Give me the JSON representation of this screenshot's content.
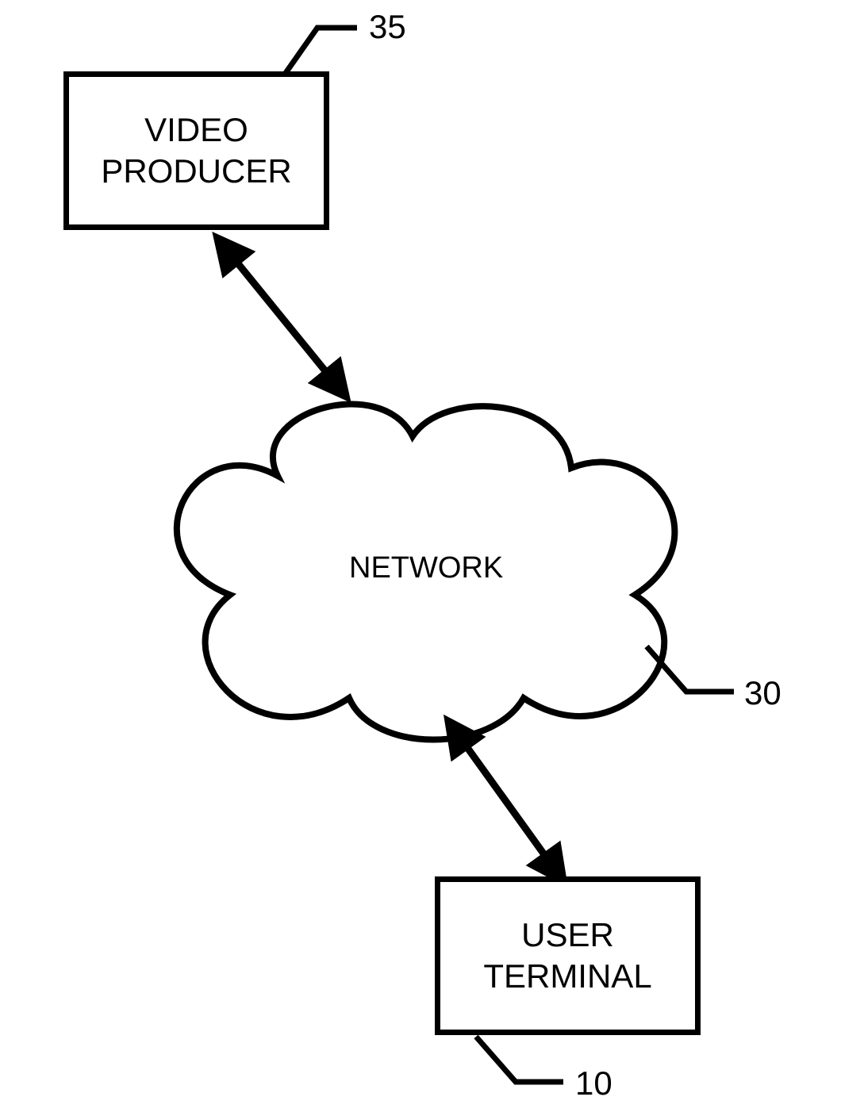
{
  "nodes": {
    "video_producer": {
      "label": "VIDEO\nPRODUCER",
      "callout": "35"
    },
    "network": {
      "label": "NETWORK",
      "callout": "30"
    },
    "user_terminal": {
      "label": "USER\nTERMINAL",
      "callout": "10"
    }
  }
}
